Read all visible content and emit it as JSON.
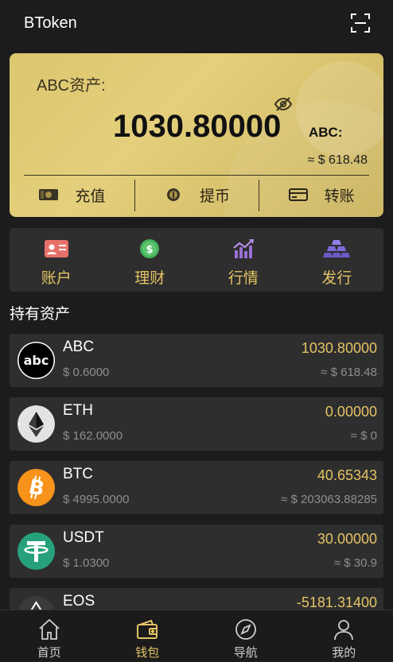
{
  "header": {
    "title": "BToken",
    "scan_icon": "scan-icon"
  },
  "card": {
    "asset_label": "ABC资产:",
    "balance": "1030.80000",
    "currency": "ABC:",
    "fiat": "≈ $ 618.48",
    "visibility_icon": "eye-off-icon",
    "actions": [
      {
        "label": "充值",
        "icon": "cash-icon"
      },
      {
        "label": "提币",
        "icon": "coin-icon"
      },
      {
        "label": "转账",
        "icon": "card-icon"
      }
    ]
  },
  "quick": [
    {
      "label": "账户",
      "icon": "id-card-icon"
    },
    {
      "label": "理财",
      "icon": "dollar-coin-icon"
    },
    {
      "label": "行情",
      "icon": "trend-chart-icon"
    },
    {
      "label": "发行",
      "icon": "gold-bars-icon"
    }
  ],
  "section_title": "持有资产",
  "assets": [
    {
      "symbol": "ABC",
      "price": "$ 0.6000",
      "amount": "1030.80000",
      "value": "≈ $ 618.48",
      "icon": "abc-logo-icon"
    },
    {
      "symbol": "ETH",
      "price": "$ 162.0000",
      "amount": "0.00000",
      "value": "≈ $ 0",
      "icon": "eth-logo-icon"
    },
    {
      "symbol": "BTC",
      "price": "$ 4995.0000",
      "amount": "40.65343",
      "value": "≈ $ 203063.88285",
      "icon": "btc-logo-icon"
    },
    {
      "symbol": "USDT",
      "price": "$ 1.0300",
      "amount": "30.00000",
      "value": "≈ $ 30.9",
      "icon": "usdt-logo-icon"
    },
    {
      "symbol": "EOS",
      "price": "",
      "amount": "-5181.31400",
      "value": "",
      "icon": "eos-logo-icon"
    }
  ],
  "tabs": [
    {
      "label": "首页",
      "icon": "home-icon",
      "active": false
    },
    {
      "label": "钱包",
      "icon": "wallet-icon",
      "active": true
    },
    {
      "label": "导航",
      "icon": "compass-icon",
      "active": false
    },
    {
      "label": "我的",
      "icon": "user-icon",
      "active": false
    }
  ],
  "colors": {
    "accent": "#e3c364",
    "card_gold": "#dcc66e",
    "background": "#1c1c1c",
    "row_bg": "#2e2e2e"
  }
}
